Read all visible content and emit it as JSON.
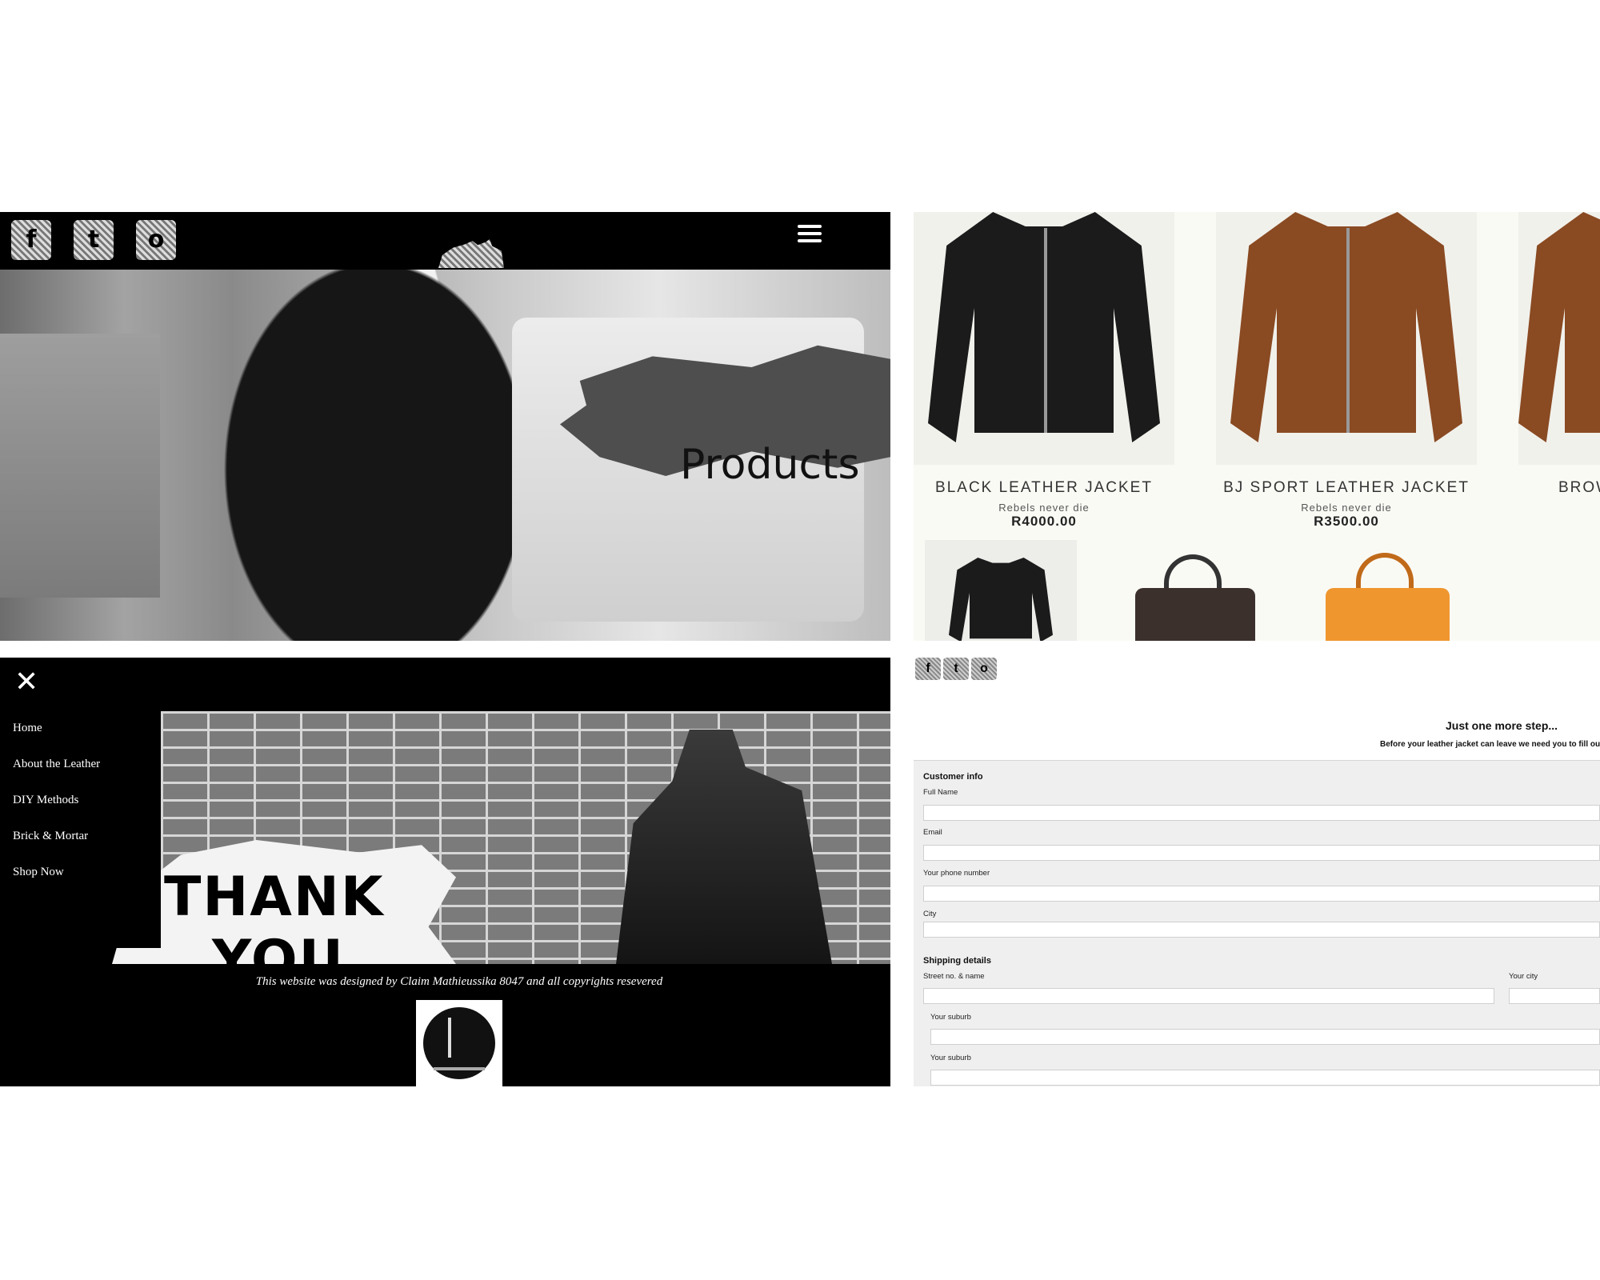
{
  "hero": {
    "social": {
      "facebook": "f",
      "twitter": "t",
      "instagram": "o"
    },
    "title": "Products"
  },
  "products": [
    {
      "name": "BLACK LEATHER JACKET",
      "tagline": "Rebels never die",
      "price": "R4000.00"
    },
    {
      "name": "BJ SPORT LEATHER JACKET",
      "tagline": "Rebels never die",
      "price": "R3500.00"
    },
    {
      "name": "BROWI",
      "tagline": "",
      "price": ""
    }
  ],
  "menu": {
    "close_glyph": "✕",
    "items": [
      "Home",
      "About the Leather",
      "DIY Methods",
      "Brick & Mortar",
      "Shop Now"
    ],
    "banner_text_1": "THANK",
    "banner_text_2": "YOU",
    "footer": "This website was designed by Claim Mathieussika 8047 and all copyrights resevered"
  },
  "form": {
    "title": "Just one more step...",
    "subtitle": "Before your leather jacket can leave we need you to fill out th",
    "customer_section": "Customer info",
    "labels": {
      "full_name": "Full Name",
      "email": "Email",
      "phone": "Your phone number",
      "city": "City",
      "street": "Street no. & name",
      "your_city": "Your city",
      "suburb_1": "Your suburb",
      "suburb_2": "Your suburb"
    },
    "shipping_section": "Shipping details"
  },
  "colors": {
    "background": "#ffffff",
    "bar": "#000000",
    "form_bg": "#efefef",
    "brown": "#8a4a22"
  }
}
